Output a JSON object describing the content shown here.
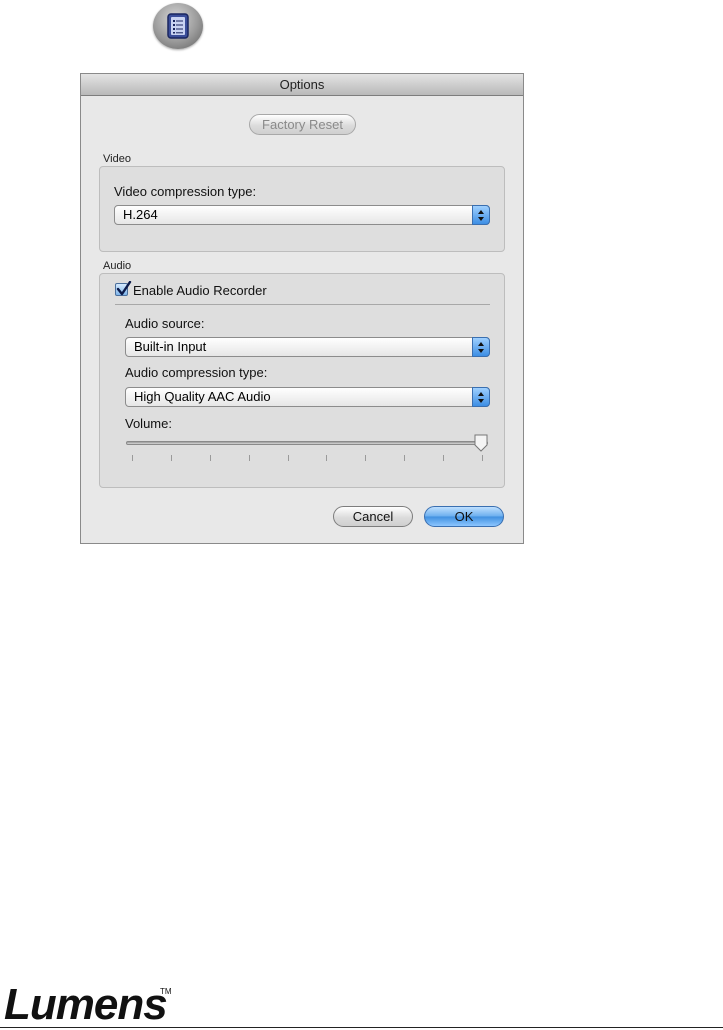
{
  "window": {
    "title": "Options"
  },
  "buttons": {
    "factory_reset": "Factory Reset",
    "cancel": "Cancel",
    "ok": "OK"
  },
  "video": {
    "group_label": "Video",
    "compression_label": "Video compression type:",
    "compression_value": "H.264"
  },
  "audio": {
    "group_label": "Audio",
    "enable_label": "Enable Audio Recorder",
    "enable_checked": true,
    "source_label": "Audio source:",
    "source_value": "Built-in Input",
    "compression_label": "Audio compression type:",
    "compression_value": "High Quality AAC Audio",
    "volume_label": "Volume:",
    "volume_level": 1.0
  },
  "brand": {
    "logo_text": "Lumens",
    "trademark": "TM"
  },
  "icons": {
    "top_icon": "options-list-icon",
    "popup_arrows": "up-down-arrows-icon",
    "check": "checkmark-icon"
  }
}
